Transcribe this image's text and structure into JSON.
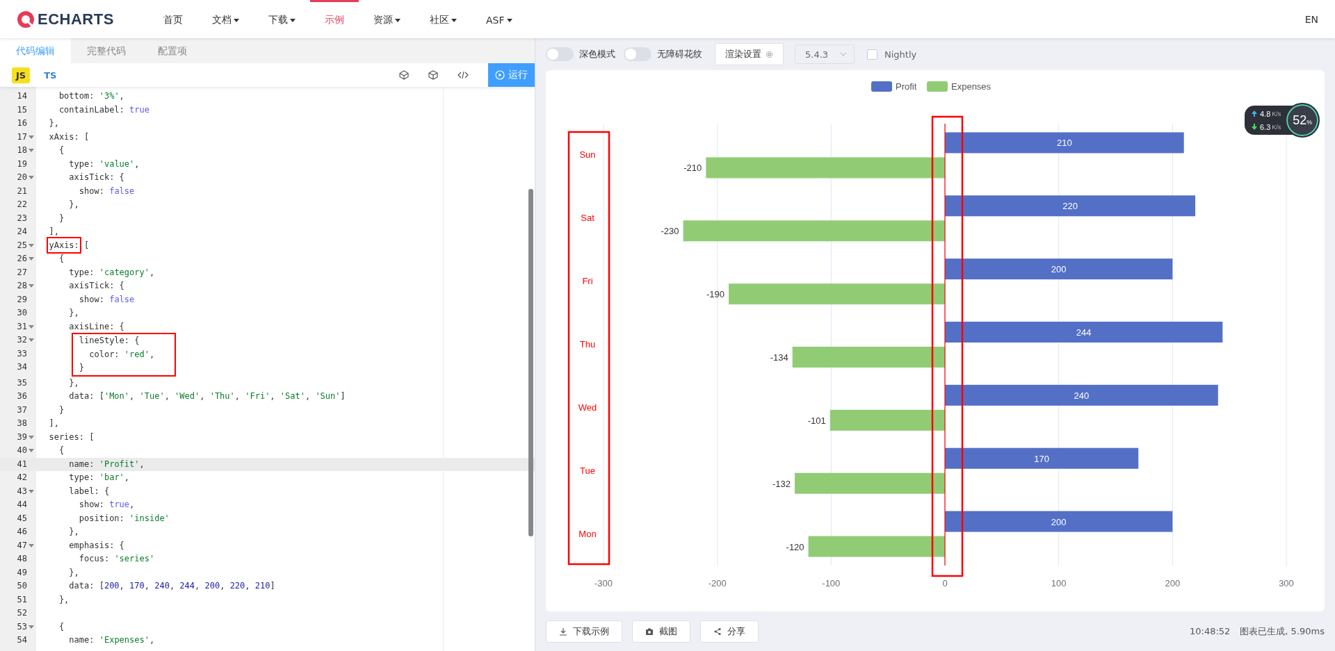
{
  "nav": {
    "logo": "ECHARTS",
    "items": [
      {
        "label": "首页",
        "dropdown": false,
        "selected": false
      },
      {
        "label": "文档",
        "dropdown": true,
        "selected": false
      },
      {
        "label": "下载",
        "dropdown": true,
        "selected": false
      },
      {
        "label": "示例",
        "dropdown": false,
        "selected": true
      },
      {
        "label": "资源",
        "dropdown": true,
        "selected": false
      },
      {
        "label": "社区",
        "dropdown": true,
        "selected": false
      },
      {
        "label": "ASF",
        "dropdown": true,
        "selected": false
      }
    ],
    "language": "EN"
  },
  "editor": {
    "tabs": [
      {
        "label": "代码编辑",
        "selected": true
      },
      {
        "label": "完整代码",
        "selected": false
      },
      {
        "label": "配置项",
        "selected": false
      }
    ],
    "languages": [
      {
        "label": "JS",
        "selected": true
      },
      {
        "label": "TS",
        "selected": false
      }
    ],
    "run_button": "运行",
    "lines": [
      {
        "n": "14",
        "t": [
          {
            "text": "    bottom: ",
            "kind": "plain"
          },
          {
            "text": "'3%'",
            "kind": "string"
          },
          {
            "text": ",",
            "kind": "plain"
          }
        ]
      },
      {
        "n": "15",
        "t": [
          {
            "text": "    containLabel: ",
            "kind": "plain"
          },
          {
            "text": "true",
            "kind": "keyword"
          }
        ]
      },
      {
        "n": "16",
        "t": [
          {
            "text": "  },",
            "kind": "plain"
          }
        ]
      },
      {
        "n": "17",
        "fold": true,
        "t": [
          {
            "text": "  xAxis: [",
            "kind": "plain"
          }
        ]
      },
      {
        "n": "18",
        "fold": true,
        "t": [
          {
            "text": "    {",
            "kind": "plain"
          }
        ]
      },
      {
        "n": "19",
        "t": [
          {
            "text": "      type: ",
            "kind": "plain"
          },
          {
            "text": "'value'",
            "kind": "string"
          },
          {
            "text": ",",
            "kind": "plain"
          }
        ]
      },
      {
        "n": "20",
        "fold": true,
        "t": [
          {
            "text": "      axisTick: {",
            "kind": "plain"
          }
        ]
      },
      {
        "n": "21",
        "t": [
          {
            "text": "        show: ",
            "kind": "plain"
          },
          {
            "text": "false",
            "kind": "keyword"
          }
        ]
      },
      {
        "n": "22",
        "t": [
          {
            "text": "      },",
            "kind": "plain"
          }
        ]
      },
      {
        "n": "23",
        "t": [
          {
            "text": "    }",
            "kind": "plain"
          }
        ]
      },
      {
        "n": "24",
        "t": [
          {
            "text": "  ],",
            "kind": "plain"
          }
        ]
      },
      {
        "n": "25",
        "fold": true,
        "t": [
          {
            "text": "  yAxis:",
            "kind": "plain",
            "boxed": true
          },
          {
            "text": " [",
            "kind": "plain"
          }
        ]
      },
      {
        "n": "26",
        "fold": true,
        "t": [
          {
            "text": "    {",
            "kind": "plain"
          }
        ]
      },
      {
        "n": "27",
        "t": [
          {
            "text": "      type: ",
            "kind": "plain"
          },
          {
            "text": "'category'",
            "kind": "string"
          },
          {
            "text": ",",
            "kind": "plain"
          }
        ]
      },
      {
        "n": "28",
        "fold": true,
        "t": [
          {
            "text": "      axisTick: {",
            "kind": "plain"
          }
        ]
      },
      {
        "n": "29",
        "t": [
          {
            "text": "        show: ",
            "kind": "plain"
          },
          {
            "text": "false",
            "kind": "keyword"
          }
        ]
      },
      {
        "n": "30",
        "t": [
          {
            "text": "      },",
            "kind": "plain"
          }
        ]
      },
      {
        "n": "31",
        "fold": true,
        "t": [
          {
            "text": "      axisLine: {",
            "kind": "plain"
          }
        ]
      },
      {
        "n": "32",
        "fold": true,
        "boxed": true,
        "t": [
          {
            "text": "        lineStyle: {",
            "kind": "plain"
          }
        ]
      },
      {
        "n": "33",
        "boxed": true,
        "t": [
          {
            "text": "          color: ",
            "kind": "plain"
          },
          {
            "text": "'red'",
            "kind": "string"
          },
          {
            "text": ",",
            "kind": "plain"
          }
        ]
      },
      {
        "n": "34",
        "boxed": true,
        "t": [
          {
            "text": "        }",
            "kind": "plain"
          }
        ]
      },
      {
        "n": "35",
        "t": [
          {
            "text": "      },",
            "kind": "plain"
          }
        ]
      },
      {
        "n": "36",
        "t": [
          {
            "text": "      data: [",
            "kind": "plain"
          },
          {
            "text": "'Mon'",
            "kind": "string"
          },
          {
            "text": ", ",
            "kind": "plain"
          },
          {
            "text": "'Tue'",
            "kind": "string"
          },
          {
            "text": ", ",
            "kind": "plain"
          },
          {
            "text": "'Wed'",
            "kind": "string"
          },
          {
            "text": ", ",
            "kind": "plain"
          },
          {
            "text": "'Thu'",
            "kind": "string"
          },
          {
            "text": ", ",
            "kind": "plain"
          },
          {
            "text": "'Fri'",
            "kind": "string"
          },
          {
            "text": ", ",
            "kind": "plain"
          },
          {
            "text": "'Sat'",
            "kind": "string"
          },
          {
            "text": ", ",
            "kind": "plain"
          },
          {
            "text": "'Sun'",
            "kind": "string"
          },
          {
            "text": "]",
            "kind": "plain"
          }
        ]
      },
      {
        "n": "37",
        "t": [
          {
            "text": "    }",
            "kind": "plain"
          }
        ]
      },
      {
        "n": "38",
        "t": [
          {
            "text": "  ],",
            "kind": "plain"
          }
        ]
      },
      {
        "n": "39",
        "fold": true,
        "t": [
          {
            "text": "  series: [",
            "kind": "plain"
          }
        ]
      },
      {
        "n": "40",
        "fold": true,
        "t": [
          {
            "text": "    {",
            "kind": "plain"
          }
        ]
      },
      {
        "n": "41",
        "current": true,
        "t": [
          {
            "text": "      name: ",
            "kind": "plain"
          },
          {
            "text": "'Profit'",
            "kind": "string"
          },
          {
            "text": ",",
            "kind": "plain"
          }
        ]
      },
      {
        "n": "42",
        "t": [
          {
            "text": "      type: ",
            "kind": "plain"
          },
          {
            "text": "'bar'",
            "kind": "string"
          },
          {
            "text": ",",
            "kind": "plain"
          }
        ]
      },
      {
        "n": "43",
        "fold": true,
        "t": [
          {
            "text": "      label: {",
            "kind": "plain"
          }
        ]
      },
      {
        "n": "44",
        "t": [
          {
            "text": "        show: ",
            "kind": "plain"
          },
          {
            "text": "true",
            "kind": "keyword"
          },
          {
            "text": ",",
            "kind": "plain"
          }
        ]
      },
      {
        "n": "45",
        "t": [
          {
            "text": "        position: ",
            "kind": "plain"
          },
          {
            "text": "'inside'",
            "kind": "string"
          }
        ]
      },
      {
        "n": "46",
        "t": [
          {
            "text": "      },",
            "kind": "plain"
          }
        ]
      },
      {
        "n": "47",
        "fold": true,
        "t": [
          {
            "text": "      emphasis: {",
            "kind": "plain"
          }
        ]
      },
      {
        "n": "48",
        "t": [
          {
            "text": "        focus: ",
            "kind": "plain"
          },
          {
            "text": "'series'",
            "kind": "string"
          }
        ]
      },
      {
        "n": "49",
        "t": [
          {
            "text": "      },",
            "kind": "plain"
          }
        ]
      },
      {
        "n": "50",
        "t": [
          {
            "text": "      data: [",
            "kind": "plain"
          },
          {
            "text": "200",
            "kind": "number"
          },
          {
            "text": ", ",
            "kind": "plain"
          },
          {
            "text": "170",
            "kind": "number"
          },
          {
            "text": ", ",
            "kind": "plain"
          },
          {
            "text": "240",
            "kind": "number"
          },
          {
            "text": ", ",
            "kind": "plain"
          },
          {
            "text": "244",
            "kind": "number"
          },
          {
            "text": ", ",
            "kind": "plain"
          },
          {
            "text": "200",
            "kind": "number"
          },
          {
            "text": ", ",
            "kind": "plain"
          },
          {
            "text": "220",
            "kind": "number"
          },
          {
            "text": ", ",
            "kind": "plain"
          },
          {
            "text": "210",
            "kind": "number"
          },
          {
            "text": "]",
            "kind": "plain"
          }
        ]
      },
      {
        "n": "51",
        "t": [
          {
            "text": "    },",
            "kind": "plain"
          }
        ]
      },
      {
        "n": "52"
      },
      {
        "n": "53",
        "fold": true,
        "t": [
          {
            "text": "    {",
            "kind": "plain"
          }
        ]
      },
      {
        "n": "54",
        "t": [
          {
            "text": "      name: ",
            "kind": "plain"
          },
          {
            "text": "'Expenses'",
            "kind": "string"
          },
          {
            "text": ",",
            "kind": "plain"
          }
        ]
      }
    ]
  },
  "preview": {
    "toggles": [
      {
        "label": "深色模式",
        "on": false
      },
      {
        "label": "无障碍花纹",
        "on": false
      }
    ],
    "render_button": "渲染设置",
    "version": "5.4.3",
    "nightly": {
      "label": "Nightly",
      "checked": false
    },
    "chart_data": {
      "type": "bar",
      "orientation": "horizontal",
      "data_labels": true,
      "grid": true,
      "legend": true,
      "value_labels": [
        [
          "210",
          "220",
          "200",
          "244",
          "240",
          "170",
          "200"
        ],
        [
          "-210",
          "-230",
          "-190",
          "-134",
          "-101",
          "-132",
          "-120"
        ]
      ],
      "categories": [
        "Sun",
        "Sat",
        "Fri",
        "Thu",
        "Wed",
        "Tue",
        "Mon"
      ],
      "series": [
        {
          "name": "Profit",
          "color": "#5470c6",
          "values": [
            210,
            220,
            200,
            244,
            240,
            170,
            200
          ]
        },
        {
          "name": "Expenses",
          "color": "#91cc75",
          "values": [
            -210,
            -230,
            -190,
            -134,
            -101,
            -132,
            -120
          ]
        }
      ],
      "xlim": [
        -300,
        300
      ],
      "xticks": [
        {
          "value": -300,
          "label": "-300"
        },
        {
          "value": -200,
          "label": "-200"
        },
        {
          "value": -100,
          "label": "-100"
        },
        {
          "value": 0,
          "label": "0"
        },
        {
          "value": 100,
          "label": "100"
        },
        {
          "value": 200,
          "label": "200"
        },
        {
          "value": 300,
          "label": "300"
        }
      ],
      "ref_lines": [
        {
          "axis": "x",
          "value": 0,
          "color": "#ff0000"
        }
      ]
    },
    "annotation_boxes": {
      "category_labels": true,
      "zero_axis": true
    },
    "actions": [
      "下载示例",
      "截图",
      "分享"
    ],
    "time": "10:48:52",
    "status": "图表已生成, 5.90ms"
  },
  "speed_widget": {
    "up": "4.8",
    "up_unit": "K/s",
    "down": "6.3",
    "down_unit": "K/s",
    "percent": "52",
    "percent_unit": "%"
  }
}
